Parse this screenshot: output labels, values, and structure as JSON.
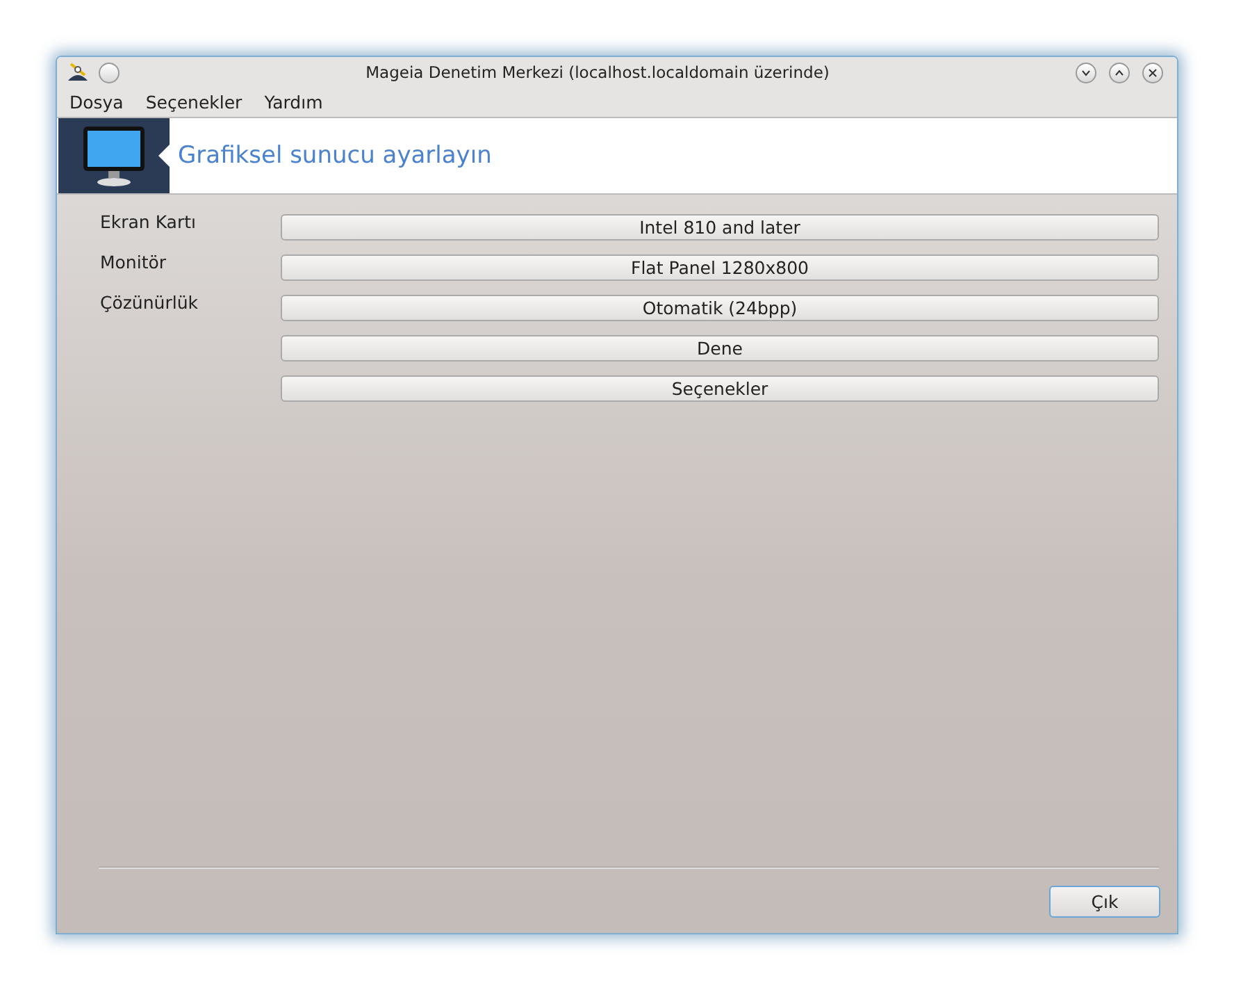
{
  "window": {
    "title": "Mageia Denetim Merkezi  (localhost.localdomain üzerinde)"
  },
  "menu": [
    "Dosya",
    "Seçenekler",
    "Yardım"
  ],
  "header": {
    "title": "Grafiksel sunucu ayarlayın"
  },
  "rows": [
    {
      "label": "Ekran Kartı",
      "button": "Intel 810 and later"
    },
    {
      "label": "Monitör",
      "button": "Flat Panel 1280x800"
    },
    {
      "label": "Çözünürlük",
      "button": "Otomatik (24bpp)"
    },
    {
      "button": "Dene"
    },
    {
      "button": "Seçenekler"
    }
  ],
  "footer": {
    "button": "Çık"
  }
}
